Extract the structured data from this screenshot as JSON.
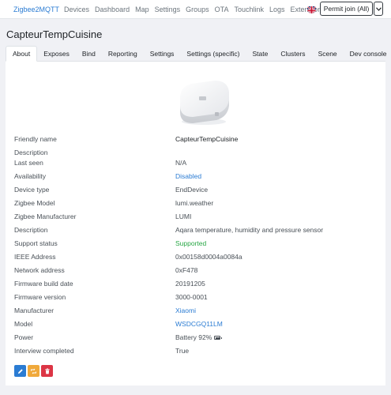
{
  "navbar": {
    "brand": "Zigbee2MQTT",
    "links": [
      "Devices",
      "Dashboard",
      "Map",
      "Settings",
      "Groups",
      "OTA",
      "Touchlink",
      "Logs",
      "Extensions"
    ],
    "language_icon": "uk-flag-icon",
    "permit_join_label": "Permit join (All)"
  },
  "device": {
    "title": "CapteurTempCuisine",
    "image_icon": "aqara-sensor-image"
  },
  "tabs": [
    {
      "label": "About",
      "active": true
    },
    {
      "label": "Exposes"
    },
    {
      "label": "Bind"
    },
    {
      "label": "Reporting"
    },
    {
      "label": "Settings"
    },
    {
      "label": "Settings (specific)"
    },
    {
      "label": "State"
    },
    {
      "label": "Clusters"
    },
    {
      "label": "Scene"
    },
    {
      "label": "Dev console"
    }
  ],
  "about": {
    "rows": [
      {
        "label": "Friendly name",
        "value": "CapteurTempCuisine"
      },
      {
        "label": "Description",
        "value": ""
      },
      {
        "label": "Last seen",
        "value": "N/A"
      },
      {
        "label": "Availability",
        "value": "Disabled"
      },
      {
        "label": "Device type",
        "value": "EndDevice"
      },
      {
        "label": "Zigbee Model",
        "value": "lumi.weather"
      },
      {
        "label": "Zigbee Manufacturer",
        "value": "LUMI"
      },
      {
        "label": "Description",
        "value": "Aqara temperature, humidity and pressure sensor"
      },
      {
        "label": "Support status",
        "value": "Supported"
      },
      {
        "label": "IEEE Address",
        "value": "0x00158d0004a0084a"
      },
      {
        "label": "Network address",
        "value": "0xF478"
      },
      {
        "label": "Firmware build date",
        "value": "20191205"
      },
      {
        "label": "Firmware version",
        "value": "3000-0001"
      },
      {
        "label": "Manufacturer",
        "value": "Xiaomi"
      },
      {
        "label": "Model",
        "value": "WSDCGQ11LM"
      },
      {
        "label": "Power",
        "value": "Battery 92%"
      },
      {
        "label": "Interview completed",
        "value": "True"
      }
    ]
  },
  "actions": {
    "edit_icon": "edit-icon",
    "reconfigure_icon": "refresh-icon",
    "remove_icon": "trash-icon"
  },
  "colors": {
    "primary": "#2b7cd3",
    "success": "#28a745",
    "warning": "#f0a93b",
    "danger": "#dc3545"
  }
}
